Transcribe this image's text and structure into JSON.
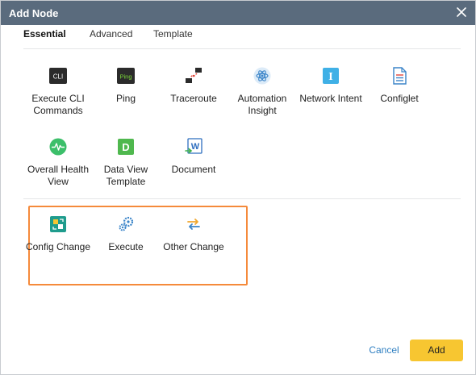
{
  "dialog": {
    "title": "Add Node",
    "close_icon": "close-icon"
  },
  "tabs": [
    {
      "label": "Essential",
      "active": true
    },
    {
      "label": "Advanced",
      "active": false
    },
    {
      "label": "Template",
      "active": false
    }
  ],
  "nodes": {
    "cli": {
      "label": "Execute CLI Commands",
      "icon": "cli-icon",
      "icon_text": "CLI"
    },
    "ping": {
      "label": "Ping",
      "icon": "ping-icon",
      "icon_text": "Ping"
    },
    "traceroute": {
      "label": "Traceroute",
      "icon": "traceroute-icon"
    },
    "automation": {
      "label": "Automation Insight",
      "icon": "atom-icon"
    },
    "intent": {
      "label": "Network Intent",
      "icon": "intent-icon",
      "icon_text": "I"
    },
    "configlet": {
      "label": "Configlet",
      "icon": "document-lines-icon"
    },
    "health": {
      "label": "Overall Health View",
      "icon": "heartbeat-icon"
    },
    "dataview": {
      "label": "Data View Template",
      "icon": "dataview-icon",
      "icon_text": "D"
    },
    "document": {
      "label": "Document",
      "icon": "word-document-icon",
      "icon_text": "W"
    },
    "config_change": {
      "label": "Config Change",
      "icon": "config-change-icon"
    },
    "execute": {
      "label": "Execute",
      "icon": "gears-icon"
    },
    "other_change": {
      "label": "Other Change",
      "icon": "swap-arrows-icon"
    }
  },
  "footer": {
    "cancel_label": "Cancel",
    "add_label": "Add"
  },
  "colors": {
    "titlebar": "#5a6b7d",
    "highlight_border": "#f58a3b",
    "add_button": "#f7c631",
    "cancel_link": "#2f7fc1"
  }
}
